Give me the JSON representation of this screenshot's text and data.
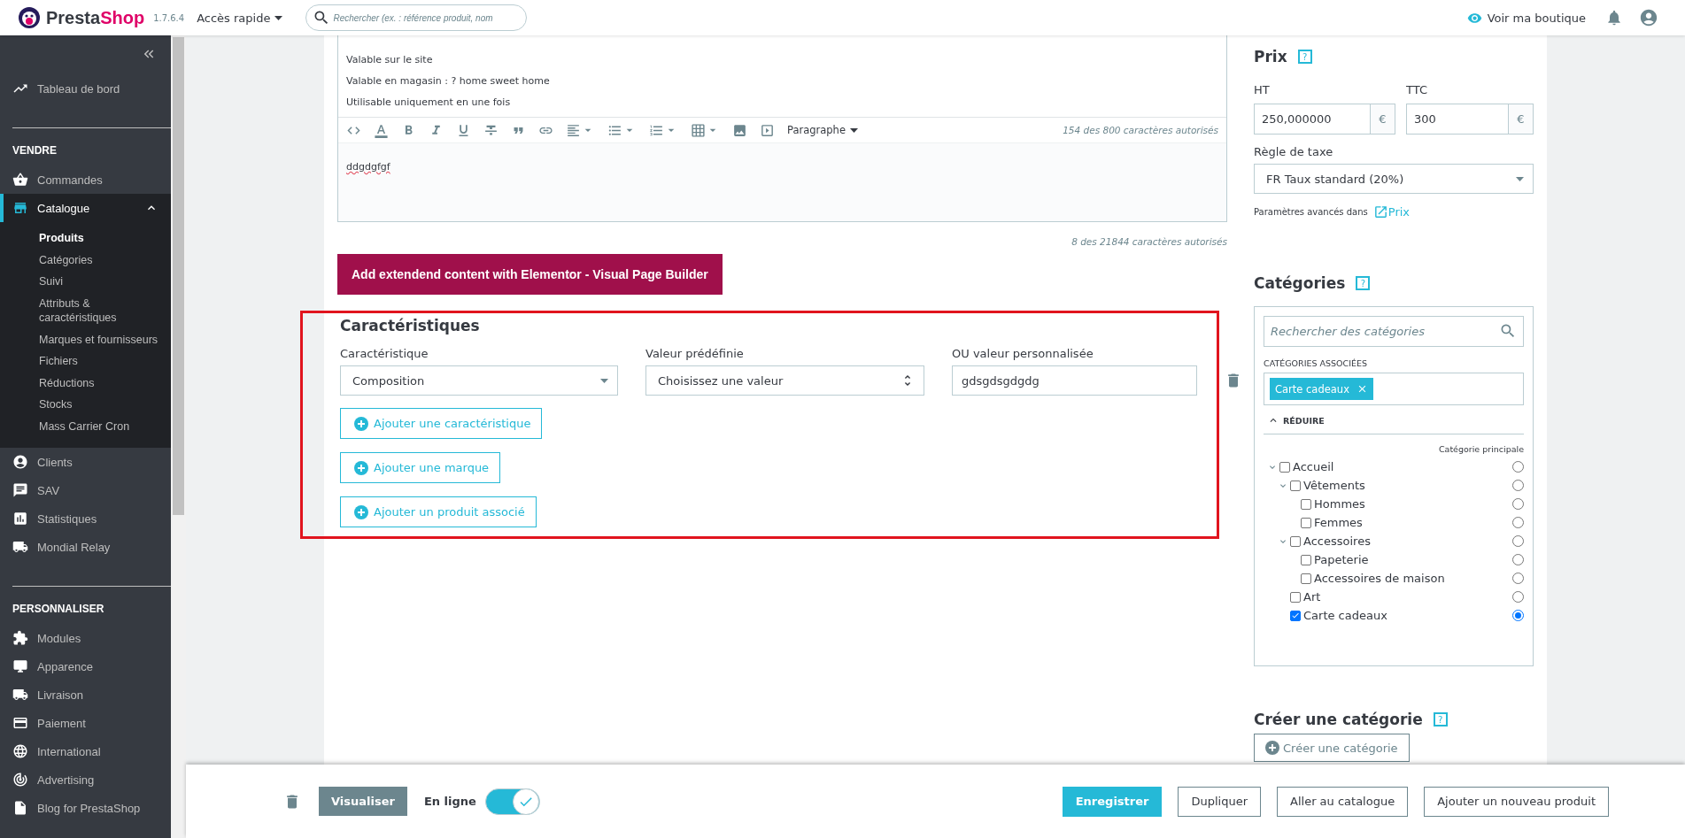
{
  "header": {
    "logo": {
      "first": "Presta",
      "second": "Shop"
    },
    "version": "1.7.6.4",
    "quick_access": "Accès rapide",
    "search": {
      "placeholder": "Rechercher (ex. : référence produit, nom"
    },
    "shop_link": "Voir ma boutique"
  },
  "sidebar": {
    "groups": [
      {
        "items": [
          {
            "label": "Tableau de bord",
            "selected": false
          }
        ]
      },
      {
        "heading": "VENDRE",
        "items": [
          {
            "label": "Commandes",
            "selected": false
          },
          {
            "label": "Catalogue",
            "selected": true,
            "expanded": true,
            "children": [
              {
                "label": "Produits",
                "selected": true
              },
              {
                "label": "Catégories",
                "selected": false
              },
              {
                "label": "Suivi",
                "selected": false
              },
              {
                "label": "Attributs & caractéristiques",
                "selected": false
              },
              {
                "label": "Marques et fournisseurs",
                "selected": false
              },
              {
                "label": "Fichiers",
                "selected": false
              },
              {
                "label": "Réductions",
                "selected": false
              },
              {
                "label": "Stocks",
                "selected": false
              },
              {
                "label": "Mass Carrier Cron",
                "selected": false
              }
            ]
          },
          {
            "label": "Clients",
            "selected": false
          },
          {
            "label": "SAV",
            "selected": false
          },
          {
            "label": "Statistiques",
            "selected": false
          },
          {
            "label": "Mondial Relay",
            "selected": false
          }
        ]
      },
      {
        "heading": "PERSONNALISER",
        "items": [
          {
            "label": "Modules",
            "selected": false
          },
          {
            "label": "Apparence",
            "selected": false
          },
          {
            "label": "Livraison",
            "selected": false
          },
          {
            "label": "Paiement",
            "selected": false
          },
          {
            "label": "International",
            "selected": false
          },
          {
            "label": "Advertising",
            "selected": false
          },
          {
            "label": "Blog for PrestaShop",
            "selected": false
          }
        ]
      }
    ]
  },
  "editor": {
    "lines": [
      "Valable sur le site",
      "Valable en magasin : ? home sweet home",
      "Utilisable uniquement en une fois"
    ],
    "format": "Paragraphe",
    "counter": "154 des 800 caractères autorisés",
    "content": "ddgdgfgf",
    "counter_total": "8 des 21844 caractères autorisés"
  },
  "elementor_button": "Add extendend content with Elementor - Visual Page Builder",
  "features": {
    "title": "Caractéristiques",
    "highlighted": true,
    "columns": [
      "Caractéristique",
      "Valeur prédéfinie",
      "OU valeur personnalisée"
    ],
    "row": {
      "feature": "Composition",
      "preset": "Choisissez une valeur",
      "custom": "gdsgdsgdgdg"
    },
    "buttons": [
      "Ajouter une caractéristique",
      "Ajouter une marque",
      "Ajouter un produit associé"
    ]
  },
  "price": {
    "title": "Prix",
    "help": "?",
    "ht_label": "HT",
    "ht_value": "250,000000",
    "ht_currency": "€",
    "ttc_label": "TTC",
    "ttc_value": "300",
    "ttc_currency": "€",
    "tax_label": "Règle de taxe",
    "tax_value": "FR Taux standard (20%)",
    "advanced_text": "Paramètres avancés dans",
    "advanced_link": "Prix"
  },
  "categories": {
    "title": "Catégories",
    "help": "?",
    "search": {
      "placeholder": "Rechercher des catégories"
    },
    "associated_label": "CATÉGORIES ASSOCIÉES",
    "tags": [
      {
        "label": "Carte cadeaux"
      }
    ],
    "collapse": "RÉDUIRE",
    "main_label": "Catégorie principale",
    "tree": [
      {
        "label": "Accueil",
        "checked": false,
        "selected": false,
        "expanded": true,
        "children": [
          {
            "label": "Vêtements",
            "checked": false,
            "selected": false,
            "expanded": true,
            "children": [
              {
                "label": "Hommes",
                "checked": false,
                "selected": false
              },
              {
                "label": "Femmes",
                "checked": false,
                "selected": false
              }
            ]
          },
          {
            "label": "Accessoires",
            "checked": false,
            "selected": false,
            "expanded": true,
            "children": [
              {
                "label": "Papeterie",
                "checked": false,
                "selected": false
              },
              {
                "label": "Accessoires de maison",
                "checked": false,
                "selected": false
              }
            ]
          },
          {
            "label": "Art",
            "checked": false,
            "selected": false
          },
          {
            "label": "Carte cadeaux",
            "checked": true,
            "selected": true
          }
        ]
      }
    ]
  },
  "create_category": {
    "title": "Créer une catégorie",
    "help": "?",
    "button": "Créer une catégorie"
  },
  "footer": {
    "preview": "Visualiser",
    "online_label": "En ligne",
    "online": true,
    "buttons": [
      {
        "label": "Enregistrer",
        "kind": "primary"
      },
      {
        "label": "Dupliquer",
        "kind": "secondary"
      },
      {
        "label": "Aller au catalogue",
        "kind": "secondary"
      },
      {
        "label": "Ajouter un nouveau produit",
        "kind": "secondary"
      }
    ]
  }
}
